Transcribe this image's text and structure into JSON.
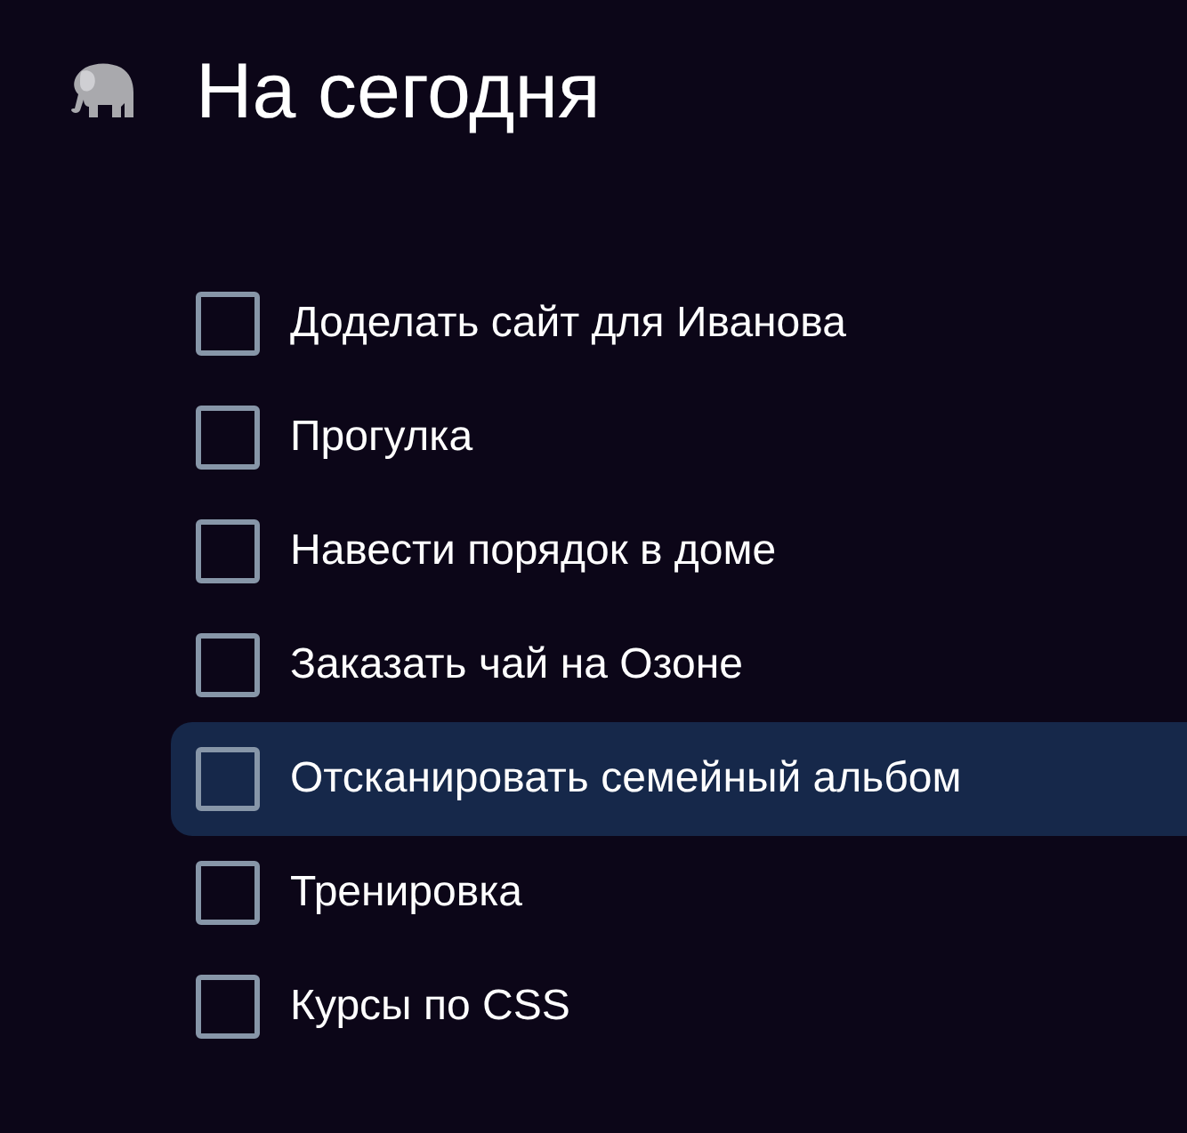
{
  "header": {
    "title": "На сегодня"
  },
  "tasks": [
    {
      "label": "Доделать сайт для Иванова",
      "checked": false,
      "selected": false
    },
    {
      "label": "Прогулка",
      "checked": false,
      "selected": false
    },
    {
      "label": "Навести порядок в доме",
      "checked": false,
      "selected": false
    },
    {
      "label": "Заказать чай на Озоне",
      "checked": false,
      "selected": false
    },
    {
      "label": "Отсканировать семейный альбом",
      "checked": false,
      "selected": true
    },
    {
      "label": "Тренировка",
      "checked": false,
      "selected": false
    },
    {
      "label": "Курсы по CSS",
      "checked": false,
      "selected": false
    }
  ]
}
